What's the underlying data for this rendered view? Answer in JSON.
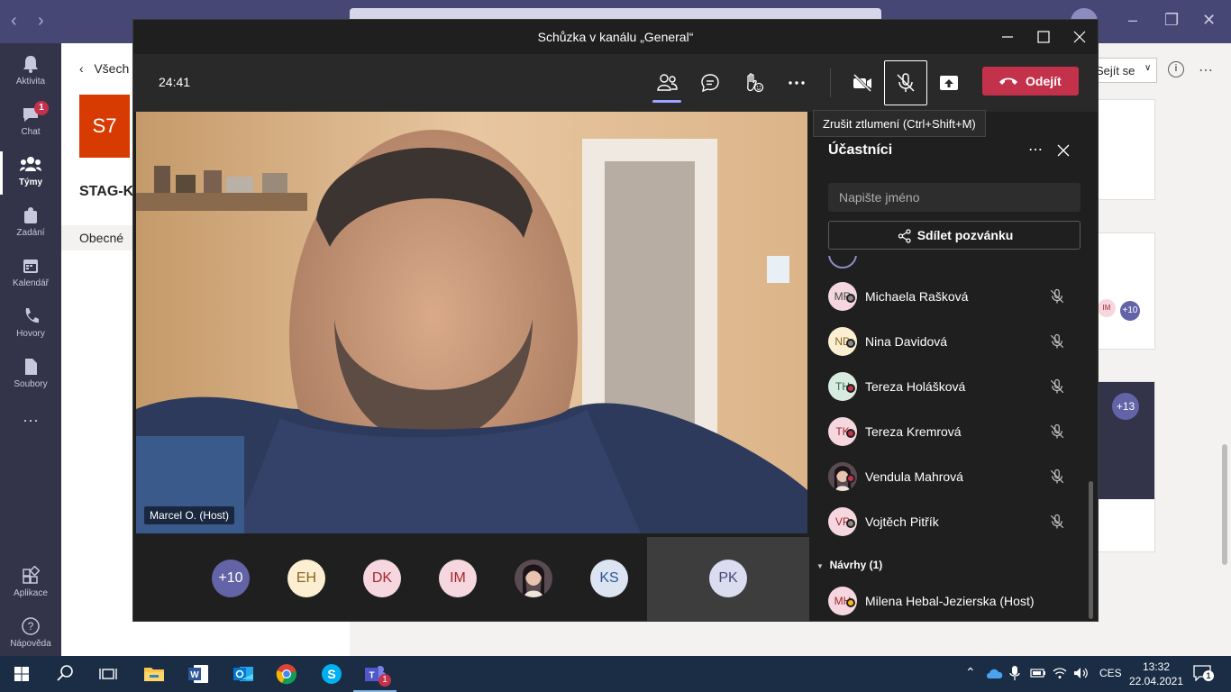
{
  "teams": {
    "rail": [
      {
        "label": "Aktivita",
        "icon": "bell-icon"
      },
      {
        "label": "Chat",
        "icon": "chat-icon",
        "badge": "1"
      },
      {
        "label": "Týmy",
        "icon": "teams-icon"
      },
      {
        "label": "Zadání",
        "icon": "assignments-icon"
      },
      {
        "label": "Kalendář",
        "icon": "calendar-icon"
      },
      {
        "label": "Hovory",
        "icon": "phone-icon"
      },
      {
        "label": "Soubory",
        "icon": "file-icon"
      },
      {
        "label": "Aplikace",
        "icon": "apps-icon"
      },
      {
        "label": "Nápověda",
        "icon": "help-icon"
      }
    ],
    "back_link": "Všech",
    "team_tile": "S7",
    "team_name": "STAG-K",
    "channel": "Obecné",
    "join_button": "Sejít se",
    "tags": {
      "left_more": "+10",
      "right_more": "+13",
      "im": "IM"
    }
  },
  "meeting": {
    "title": "Schůzka v kanálu „General“",
    "timer": "24:41",
    "leave_label": "Odejít",
    "tooltip": "Zrušit ztlumení (Ctrl+Shift+M)",
    "speaker_tag": "Marcel O. (Host)",
    "gallery": [
      {
        "initials": "+10",
        "bg": "#6264a7",
        "fg": "#ffffff"
      },
      {
        "initials": "EH",
        "bg": "#fbeed1",
        "fg": "#8a6420"
      },
      {
        "initials": "DK",
        "bg": "#f6d7df",
        "fg": "#a4262c"
      },
      {
        "initials": "IM",
        "bg": "#f6d7df",
        "fg": "#a4262c"
      },
      {
        "initials": "",
        "bg": "#5a4a52",
        "fg": "#ffffff",
        "photo": true
      },
      {
        "initials": "KS",
        "bg": "#dce4f2",
        "fg": "#2a5596"
      }
    ],
    "gallery_self": {
      "initials": "PK",
      "bg": "#dcdcf0",
      "fg": "#464775"
    },
    "participants": {
      "title": "Účastníci",
      "search_placeholder": "Napište jméno",
      "invite_label": "Sdílet pozvánku",
      "section_label": "Návrhy (1)",
      "people": [
        {
          "initials": "MR",
          "name": "Michaela Rašková",
          "status": "offline",
          "muted": true
        },
        {
          "initials": "ND",
          "name": "Nina Davidová",
          "status": "offline",
          "muted": true
        },
        {
          "initials": "TH",
          "name": "Tereza Holášková",
          "status": "busy",
          "muted": true
        },
        {
          "initials": "TK",
          "name": "Tereza Kremrová",
          "status": "busy",
          "muted": true
        },
        {
          "initials": "",
          "name": "Vendula Mahrová",
          "status": "busy",
          "muted": true,
          "photo": true
        },
        {
          "initials": "VP",
          "name": "Vojtěch Pitřík",
          "status": "offline",
          "muted": true
        }
      ],
      "suggested": [
        {
          "initials": "MH",
          "name": "Milena Hebal-Jezierska (Host)",
          "status": "away"
        }
      ]
    }
  },
  "taskbar": {
    "lang": "CES",
    "time": "13:32",
    "date": "22.04.2021",
    "notification_count": "1",
    "teams_badge": "1"
  }
}
